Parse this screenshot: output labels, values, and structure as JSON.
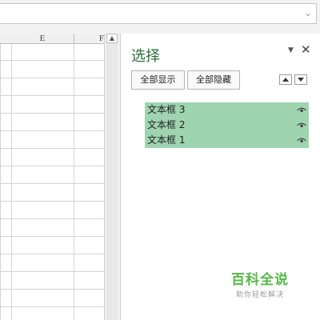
{
  "sheet": {
    "columns": [
      "E",
      "F"
    ]
  },
  "selection_pane": {
    "title": "选择",
    "show_all_label": "全部显示",
    "hide_all_label": "全部隐藏",
    "objects": [
      {
        "label": "文本框 3"
      },
      {
        "label": "文本框 2"
      },
      {
        "label": "文本框 1"
      }
    ],
    "list_bg_color": "#9fd4b1"
  },
  "watermark": {
    "main": "百科全说",
    "sub": "助你轻松解决"
  }
}
